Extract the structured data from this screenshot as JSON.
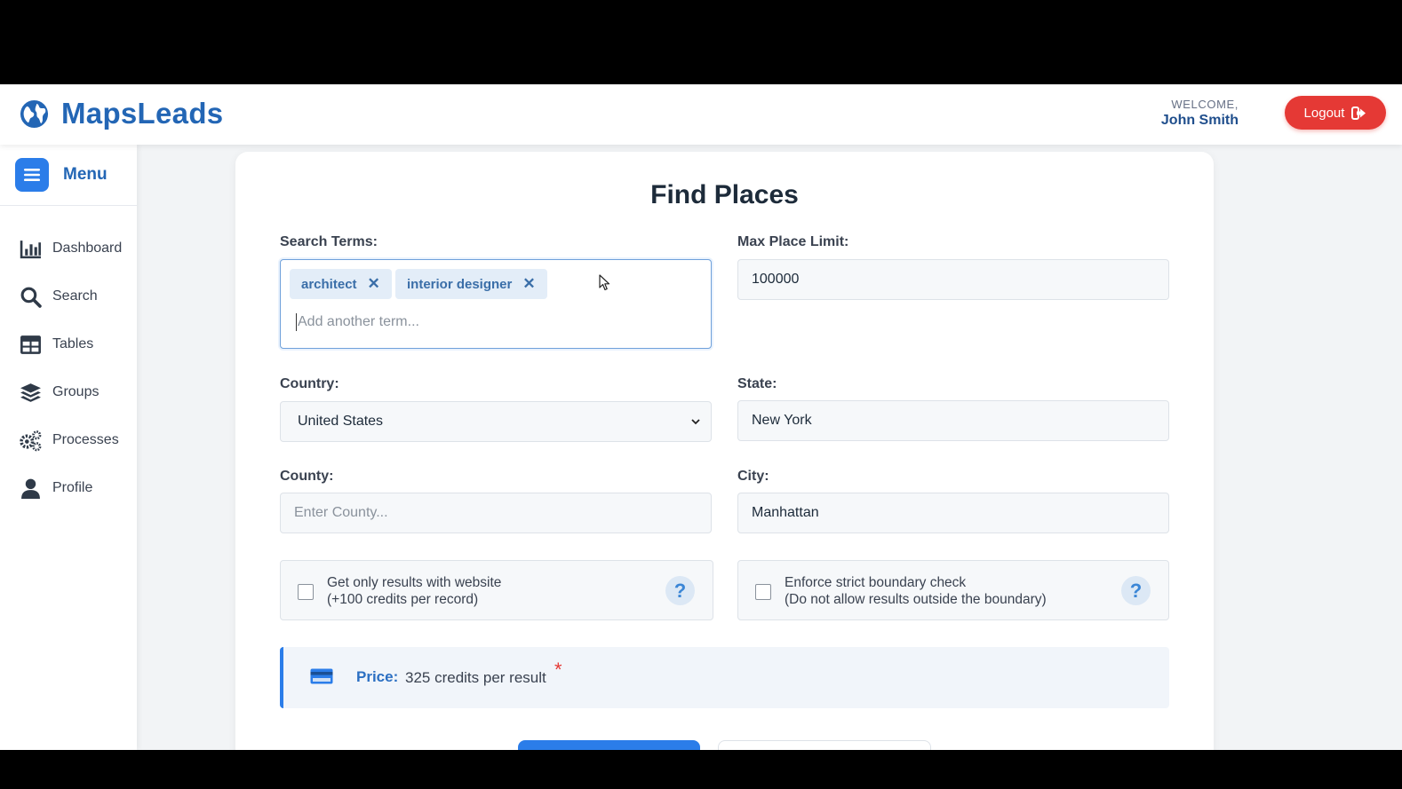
{
  "header": {
    "brand": "MapsLeads",
    "welcome_label": "WELCOME,",
    "user_name": "John Smith",
    "logout_label": "Logout"
  },
  "sidebar": {
    "menu_label": "Menu",
    "items": [
      {
        "label": "Dashboard",
        "icon": "bar-chart-icon"
      },
      {
        "label": "Search",
        "icon": "search-icon"
      },
      {
        "label": "Tables",
        "icon": "table-icon"
      },
      {
        "label": "Groups",
        "icon": "layers-icon"
      },
      {
        "label": "Processes",
        "icon": "cogs-icon"
      },
      {
        "label": "Profile",
        "icon": "user-icon"
      }
    ]
  },
  "form": {
    "title": "Find Places",
    "search_terms_label": "Search Terms:",
    "tags": [
      "architect",
      "interior designer"
    ],
    "tag_remove_glyph": "✕",
    "tag_input_placeholder": "Add another term...",
    "max_limit_label": "Max Place Limit:",
    "max_limit_value": "100000",
    "country_label": "Country:",
    "country_value": "United States",
    "state_label": "State:",
    "state_value": "New York",
    "county_label": "County:",
    "county_placeholder": "Enter County...",
    "city_label": "City:",
    "city_value": "Manhattan",
    "website_check_line1": "Get only results with website",
    "website_check_line2": "(+100 credits per record)",
    "boundary_check_line1": "Enforce strict boundary check",
    "boundary_check_line2": "(Do not allow results outside the boundary)",
    "help_glyph": "?",
    "price_label": "Price:",
    "price_value": "325 credits per result",
    "price_star": "*"
  },
  "colors": {
    "primary": "#2b7de9",
    "brand": "#2366b5",
    "danger": "#e53935"
  }
}
